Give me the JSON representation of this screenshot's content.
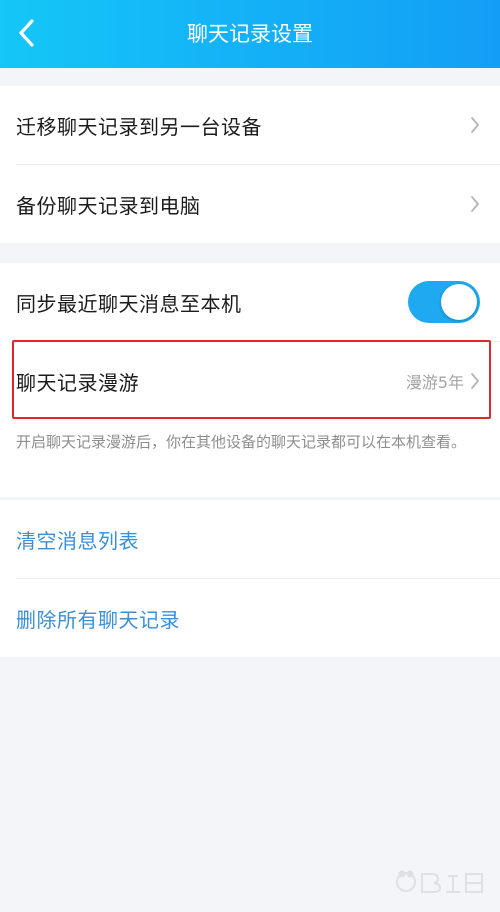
{
  "header": {
    "title": "聊天记录设置"
  },
  "group1": {
    "items": [
      {
        "label": "迁移聊天记录到另一台设备"
      },
      {
        "label": "备份聊天记录到电脑"
      }
    ]
  },
  "group2": {
    "sync": {
      "label": "同步最近聊天消息至本机",
      "toggle_on": true
    },
    "roaming": {
      "label": "聊天记录漫游",
      "value": "漫游5年"
    },
    "hint": "开启聊天记录漫游后，你在其他设备的聊天记录都可以在本机查看。"
  },
  "group3": {
    "clear_list": "清空消息列表",
    "delete_all": "删除所有聊天记录"
  },
  "colors": {
    "header_gradient_start": "#14c7f7",
    "header_gradient_end": "#139ef5",
    "link": "#3a8fd9",
    "toggle_on": "#1fa9f0",
    "highlight_border": "#e0282a"
  },
  "icons": {
    "back": "chevron-left-icon",
    "row_arrow": "chevron-right-icon"
  }
}
